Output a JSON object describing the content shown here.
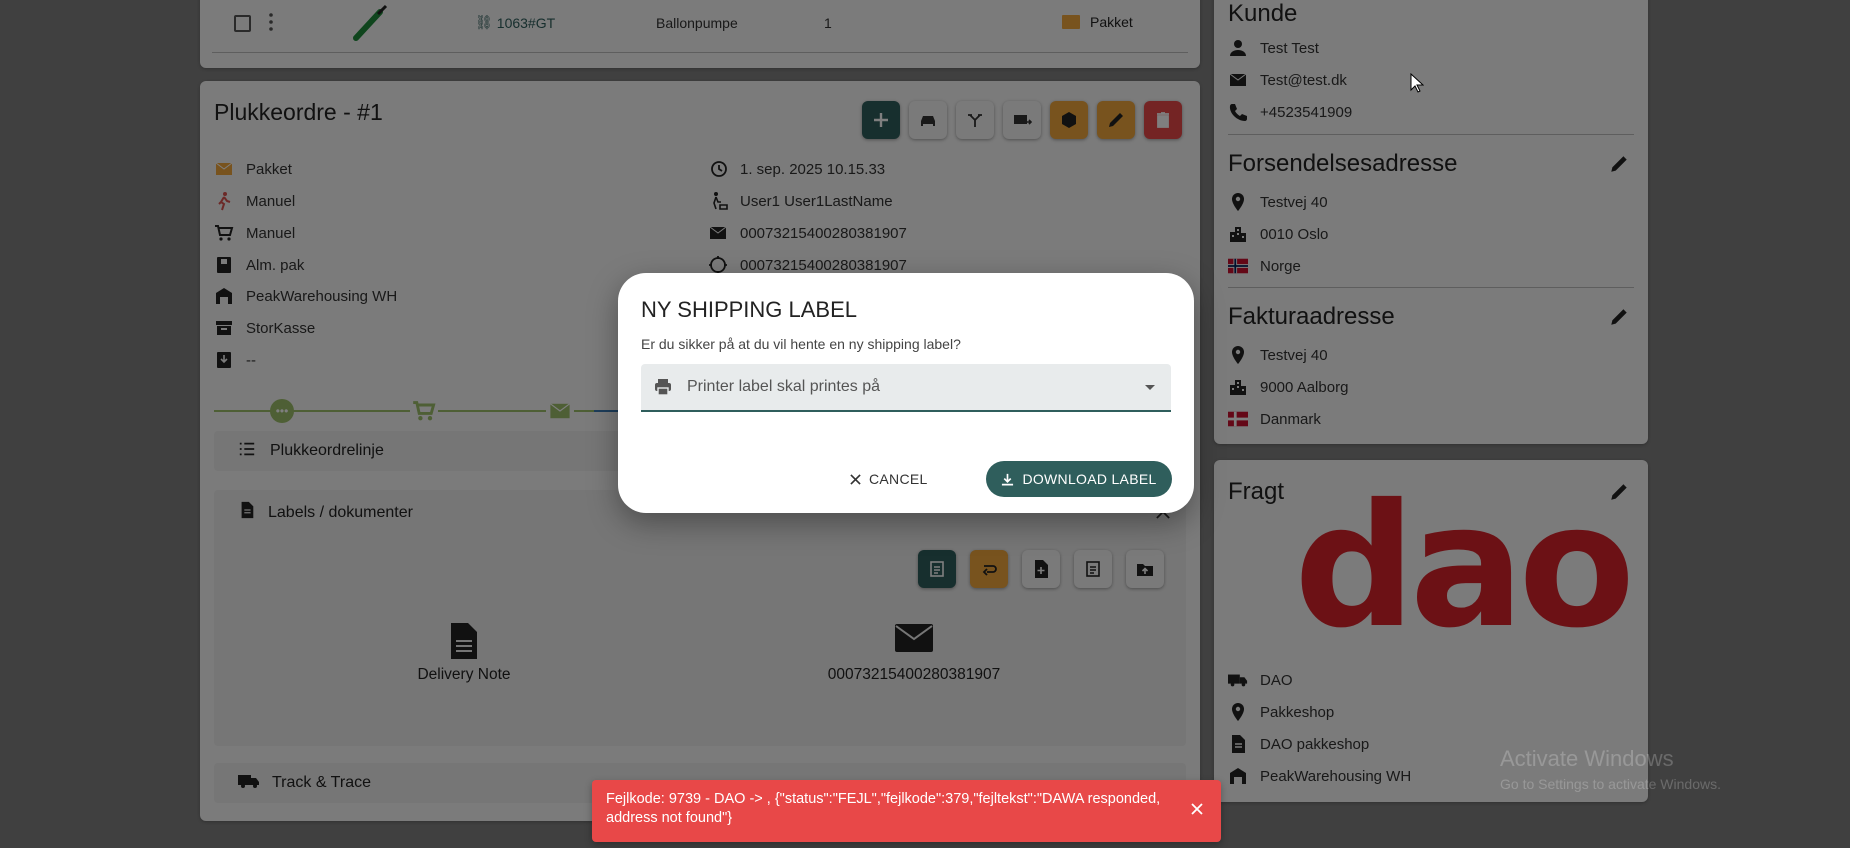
{
  "top_row": {
    "link": "1063#GT",
    "product": "Ballonpumpe",
    "qty": "1",
    "delivery": "Pakket"
  },
  "pickorder": {
    "title": "Plukkeordre - #1",
    "left_fields": [
      {
        "icon": "mail-icon",
        "value": "Pakket"
      },
      {
        "icon": "walking-icon",
        "value": "Manuel"
      },
      {
        "icon": "cart-icon",
        "value": "Manuel"
      },
      {
        "icon": "box-icon",
        "value": "Alm. pak"
      },
      {
        "icon": "warehouse-icon",
        "value": "PeakWarehousing WH"
      },
      {
        "icon": "archive-icon",
        "value": "StorKasse"
      },
      {
        "icon": "download-box-icon",
        "value": "--"
      }
    ],
    "right_fields": [
      {
        "icon": "history-icon",
        "value": "1. sep. 2025 10.15.33"
      },
      {
        "icon": "picker-icon",
        "value": "User1 User1LastName"
      },
      {
        "icon": "mail-icon",
        "value": "00073215400280381907"
      },
      {
        "icon": "crosshair-icon",
        "value": "00073215400280381907"
      }
    ],
    "sections": {
      "lines": "Plukkeordrelinje",
      "labels": "Labels / dokumenter",
      "track": "Track & Trace"
    },
    "documents": [
      {
        "icon": "document-icon",
        "label": "Delivery Note"
      },
      {
        "icon": "envelope-icon",
        "label": "00073215400280381907"
      }
    ]
  },
  "customer": {
    "title": "Kunde",
    "name": "Test Test",
    "email": "Test@test.dk",
    "phone": "+4523541909"
  },
  "shipping_address": {
    "title": "Forsendelsesadresse",
    "street": "Testvej 40",
    "city": "0010 Oslo",
    "country": "Norge"
  },
  "billing_address": {
    "title": "Fakturaadresse",
    "street": "Testvej 40",
    "city": "9000 Aalborg",
    "country": "Danmark"
  },
  "freight": {
    "title": "Fragt",
    "logo_text": "dao",
    "carrier": "DAO",
    "method": "Pakkeshop",
    "product": "DAO pakkeshop",
    "warehouse": "PeakWarehousing WH"
  },
  "watermark": {
    "line1": "Activate Windows",
    "line2": "Go to Settings to activate Windows."
  },
  "dialog": {
    "title": "NY SHIPPING LABEL",
    "message": "Er du sikker på at du vil hente en ny shipping label?",
    "printer_placeholder": "Printer label skal printes på",
    "cancel_label": "CANCEL",
    "download_label": "DOWNLOAD LABEL"
  },
  "toast": {
    "message": "Fejlkode: 9739 - DAO -> , {\"status\":\"FEJL\",\"fejlkode\":379,\"fejltekst\":\"DAWA responded, address not found\"}"
  },
  "colors": {
    "teal": "#2f5e5c",
    "orange": "#f0a63c",
    "red": "#e84848",
    "dao_red": "#d8232a",
    "flag_no": "#c8102e",
    "flag_dk": "#c8102e"
  }
}
